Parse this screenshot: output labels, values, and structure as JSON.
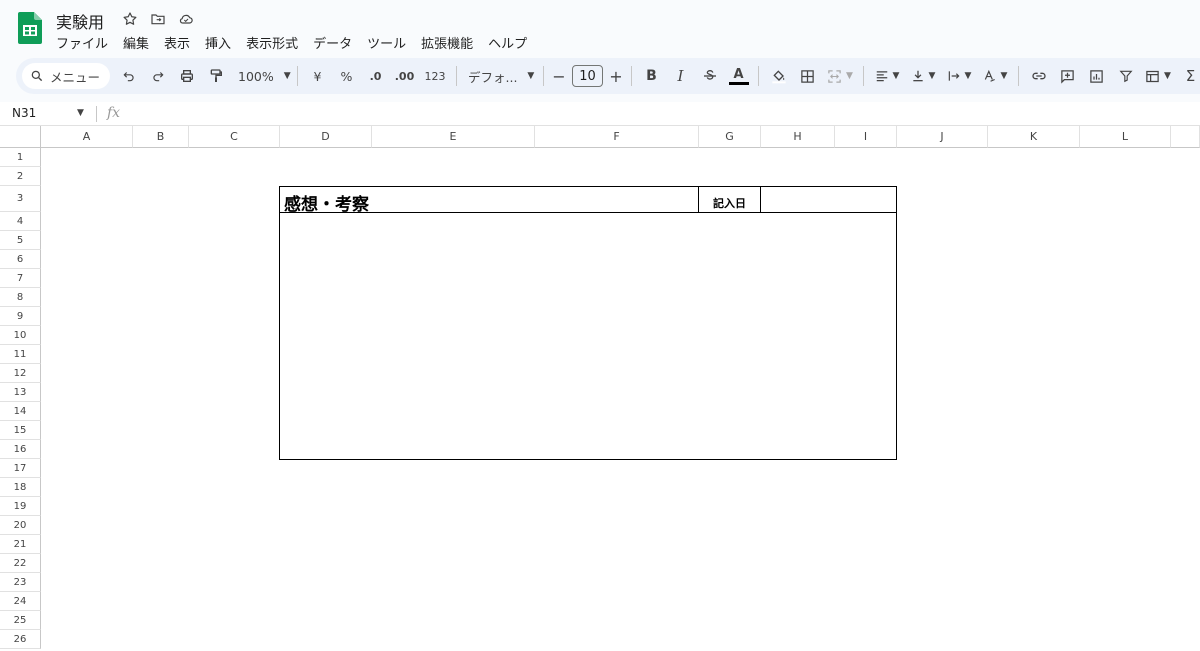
{
  "app": {
    "title": "実験用",
    "brand_color": "#0f9d58"
  },
  "title_icons": [
    "star-icon",
    "move-to-folder-icon",
    "cloud-saved-icon"
  ],
  "menu": [
    "ファイル",
    "編集",
    "表示",
    "挿入",
    "表示形式",
    "データ",
    "ツール",
    "拡張機能",
    "ヘルプ"
  ],
  "toolbar": {
    "search_label": "メニュー",
    "zoom": "100%",
    "currency": "¥",
    "percent": "%",
    "decrease_decimal": ".0",
    "increase_decimal": ".00",
    "number_format": "123",
    "font": "デフォ...",
    "font_size": "10",
    "minus": "−",
    "plus": "+",
    "bold": "B",
    "italic": "I",
    "text_color": "A"
  },
  "formula_bar": {
    "name_box": "N31",
    "fx": "fx",
    "value": ""
  },
  "columns": [
    "A",
    "B",
    "C",
    "D",
    "E",
    "F",
    "G",
    "H",
    "I",
    "J",
    "K",
    "L"
  ],
  "rows": [
    "1",
    "2",
    "3",
    "4",
    "5",
    "6",
    "7",
    "8",
    "9",
    "10",
    "11",
    "12",
    "13",
    "14",
    "15",
    "16",
    "17",
    "18",
    "19",
    "20",
    "21",
    "22",
    "23",
    "24",
    "25",
    "26"
  ],
  "cells": {
    "D3": "感想・考察",
    "G3": "記入日",
    "H3": "",
    "D4": ""
  }
}
